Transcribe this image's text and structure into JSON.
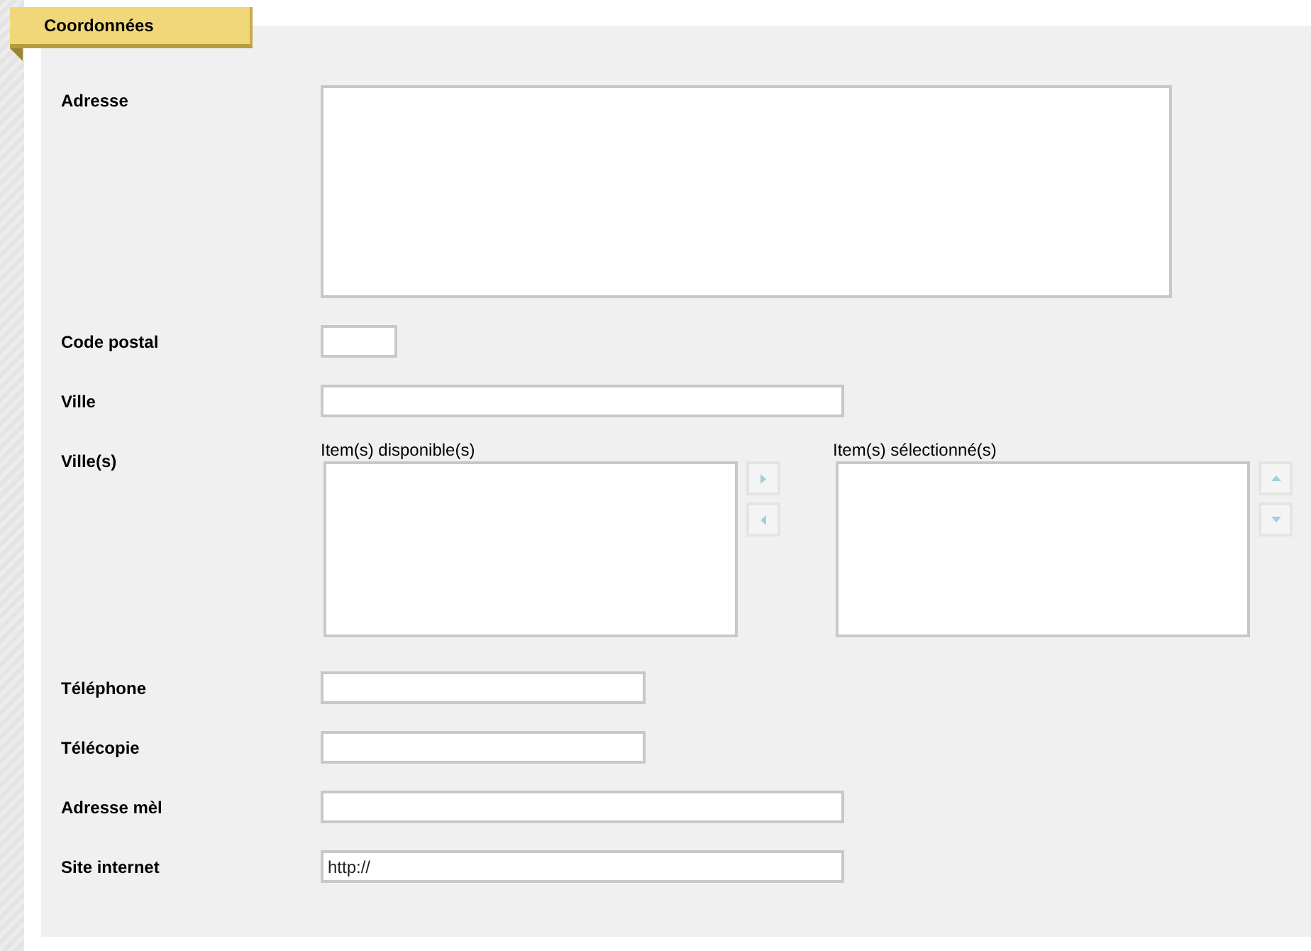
{
  "section_tab": {
    "label": "Coordonnées"
  },
  "fields": [
    {
      "kind": "textarea",
      "label": "Adresse"
    },
    {
      "kind": "short",
      "label": "Code postal"
    },
    {
      "kind": "wide",
      "label": "Ville"
    },
    {
      "kind": "duallist",
      "label": "Ville(s)",
      "available_caption": "Item(s) disponible(s)",
      "selected_caption": "Item(s) sélectionné(s)"
    },
    {
      "kind": "medium",
      "label": "Téléphone"
    },
    {
      "kind": "medium",
      "label": "Télécopie"
    },
    {
      "kind": "wide",
      "label": "Adresse mèl"
    },
    {
      "kind": "wide",
      "label": "Site internet",
      "value": "http://"
    }
  ]
}
